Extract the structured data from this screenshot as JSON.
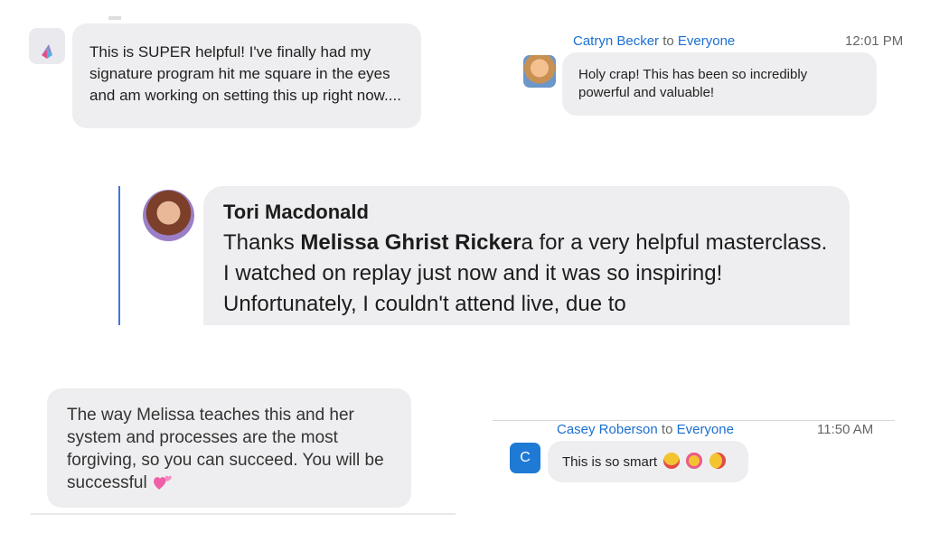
{
  "message1": {
    "text": "This is SUPER helpful! I've finally had my signature program hit me square in the eyes and am working on setting this up right now...."
  },
  "message2": {
    "sender": "Catryn Becker",
    "to_label": "to",
    "recipient": "Everyone",
    "time": "12:01 PM",
    "text": "Holy crap!  This has been so incredibly powerful and valuable!"
  },
  "comment": {
    "author": "Tori Macdonald",
    "text_before": "Thanks ",
    "mention": "Melissa Ghrist Ricker",
    "text_after": "a for a very helpful masterclass. I watched on replay just now and it was so inspiring! Unfortunately, I couldn't attend live, due to"
  },
  "message4": {
    "text": "The way Melissa teaches this and her system and processes are the most forgiving, so you can succeed. You will be successful",
    "emoji_icon": "two-hearts-icon"
  },
  "message5": {
    "sender": "Casey Roberson",
    "to_label": "to",
    "recipient": "Everyone",
    "time": "11:50 AM",
    "avatar_letter": "C",
    "text": "This is so smart",
    "emoji_icons": [
      "heart-eyes-icon",
      "smiling-hearts-icon",
      "kissing-heart-icon"
    ]
  },
  "colors": {
    "link_blue": "#1a6fd1",
    "bubble_bg": "#eeeef0",
    "quote_bar": "#3b7bd4"
  }
}
